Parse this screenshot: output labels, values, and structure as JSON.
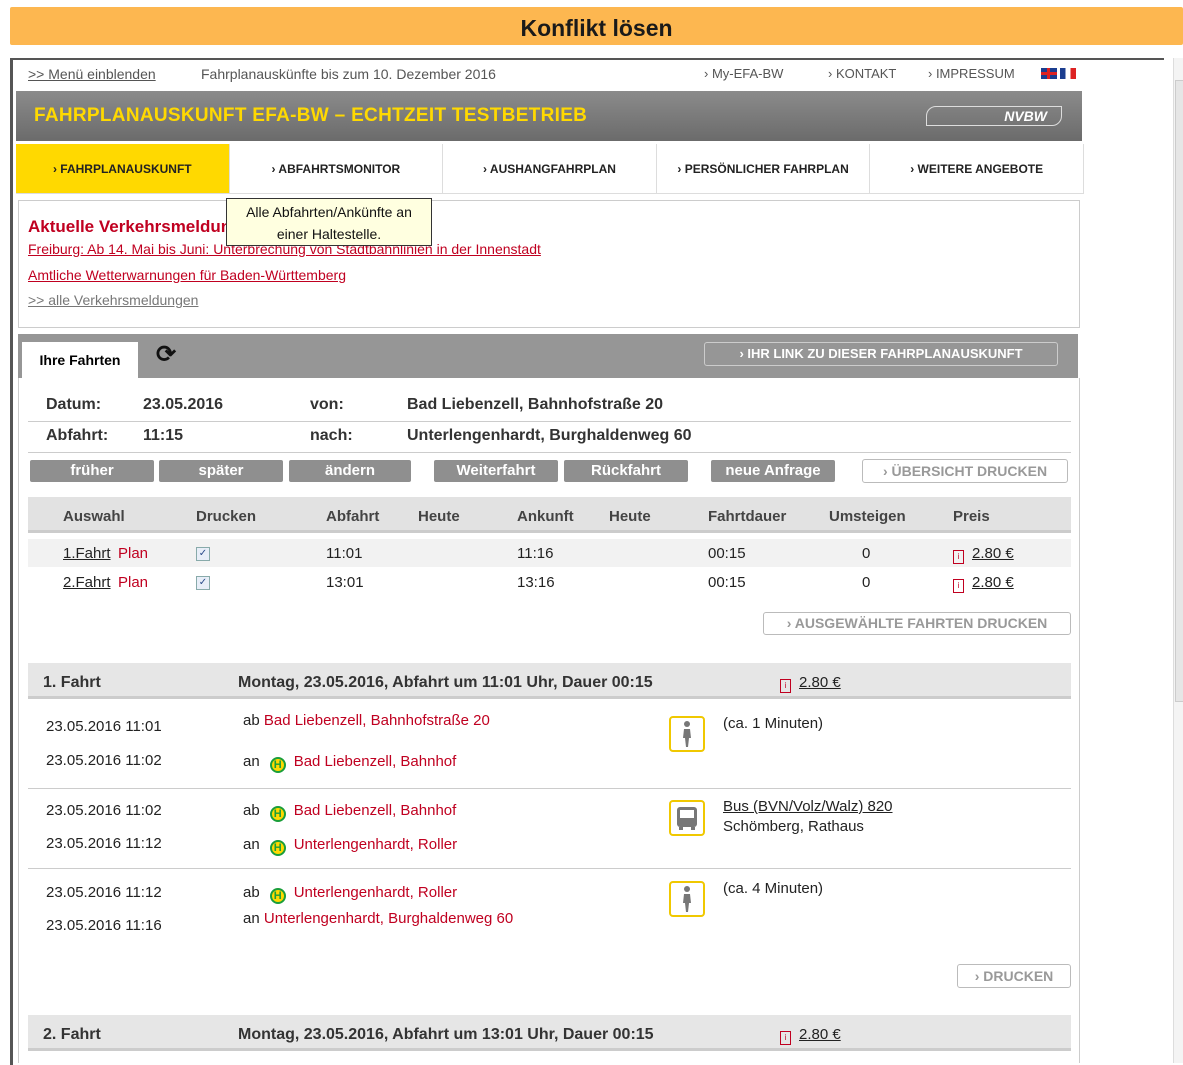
{
  "window": {
    "title": "Konflikt lösen"
  },
  "topbar": {
    "menu_link": ">> Menü einblenden",
    "subtitle": "Fahrplanauskünfte bis zum 10. Dezember 2016",
    "my_efa": "› My-EFA-BW",
    "kontakt": "› KONTAKT",
    "impressum": "› IMPRESSUM"
  },
  "banner": {
    "title": "FAHRPLANAUSKUNFT EFA-BW – ECHTZEIT TESTBETRIEB",
    "logo": "NVBW"
  },
  "tabs": [
    {
      "label": "› FAHRPLANAUSKUNFT"
    },
    {
      "label": "› ABFAHRTSMONITOR"
    },
    {
      "label": "› AUSHANGFAHRPLAN"
    },
    {
      "label": "› PERSÖNLICHER FAHRPLAN"
    },
    {
      "label": "› WEITERE ANGEBOTE"
    }
  ],
  "tooltip": {
    "line1": "Alle Abfahrten/Ankünfte an",
    "line2": "einer Haltestelle."
  },
  "news": {
    "heading": "Aktuelle Verkehrsmeldungen",
    "link1": "Freiburg: Ab 14. Mai bis Juni: Unterbrechung von Stadtbahnlinien in der Innenstadt",
    "link2": "Amtliche Wetterwarnungen für Baden-Württemberg",
    "all_link": ">> alle Verkehrsmeldungen"
  },
  "results": {
    "tab_label": "Ihre Fahrten",
    "link_button": "› IHR LINK ZU DIESER FAHRPLANAUSKUNFT",
    "datum_label": "Datum:",
    "datum_value": "23.05.2016",
    "abfahrt_label": "Abfahrt:",
    "abfahrt_value": "11:15",
    "von_label": "von:",
    "von_value": "Bad Liebenzell, Bahnhofstraße 20",
    "nach_label": "nach:",
    "nach_value": "Unterlengenhardt, Burghaldenweg 60",
    "buttons": {
      "frueher": "früher",
      "spaeter": "später",
      "aendern": "ändern",
      "weiterfahrt": "Weiterfahrt",
      "rueckfahrt": "Rückfahrt",
      "neue_anfrage": "neue Anfrage",
      "uebersicht_drucken": "› ÜBERSICHT DRUCKEN",
      "ausgewaehlte_drucken": "› AUSGEWÄHLTE FAHRTEN DRUCKEN",
      "drucken": "› DRUCKEN"
    },
    "columns": [
      "Auswahl",
      "Drucken",
      "Abfahrt",
      "Heute",
      "Ankunft",
      "Heute",
      "Fahrtdauer",
      "Umsteigen",
      "Preis"
    ],
    "trips": [
      {
        "label": "1.Fahrt",
        "plan": "Plan",
        "checked": true,
        "abfahrt": "11:01",
        "ankunft": "11:16",
        "dauer": "00:15",
        "umsteigen": "0",
        "preis": "2.80 €"
      },
      {
        "label": "2.Fahrt",
        "plan": "Plan",
        "checked": true,
        "abfahrt": "13:01",
        "ankunft": "13:16",
        "dauer": "00:15",
        "umsteigen": "0",
        "preis": "2.80 €"
      }
    ]
  },
  "detail1": {
    "label": "1. Fahrt",
    "summary": "Montag, 23.05.2016, Abfahrt um 11:01 Uhr, Dauer 00:15",
    "price": "2.80 €",
    "legs": [
      {
        "t1": "23.05.2016 11:01",
        "t2": "23.05.2016 11:02",
        "ab": "ab",
        "an": "an",
        "from": "Bad Liebenzell, Bahnhofstraße 20",
        "to": "Bad Liebenzell, Bahnhof",
        "mode": "walk-icon",
        "info1": "(ca. 1 Minuten)",
        "info2": ""
      },
      {
        "t1": "23.05.2016 11:02",
        "t2": "23.05.2016 11:12",
        "ab": "ab",
        "an": "an",
        "from": "Bad Liebenzell, Bahnhof",
        "to": "Unterlengenhardt, Roller",
        "mode": "bus-icon",
        "info1": "Bus (BVN/Volz/Walz) 820",
        "info2": "Schömberg, Rathaus"
      },
      {
        "t1": "23.05.2016 11:12",
        "t2": "23.05.2016 11:16",
        "ab": "ab",
        "an": "an",
        "from": "Unterlengenhardt, Roller",
        "to": "Unterlengenhardt, Burghaldenweg 60",
        "mode": "walk-icon",
        "info1": "(ca. 4 Minuten)",
        "info2": ""
      }
    ]
  },
  "detail2": {
    "label": "2. Fahrt",
    "summary": "Montag, 23.05.2016, Abfahrt um 13:01 Uhr, Dauer 00:15",
    "price": "2.80 €"
  },
  "stop_badge": "H",
  "colors": {
    "accent": "#ffd900",
    "title_bar": "#fdb750",
    "link_red": "#c00020",
    "banner_grey": "#7b7b7b"
  }
}
